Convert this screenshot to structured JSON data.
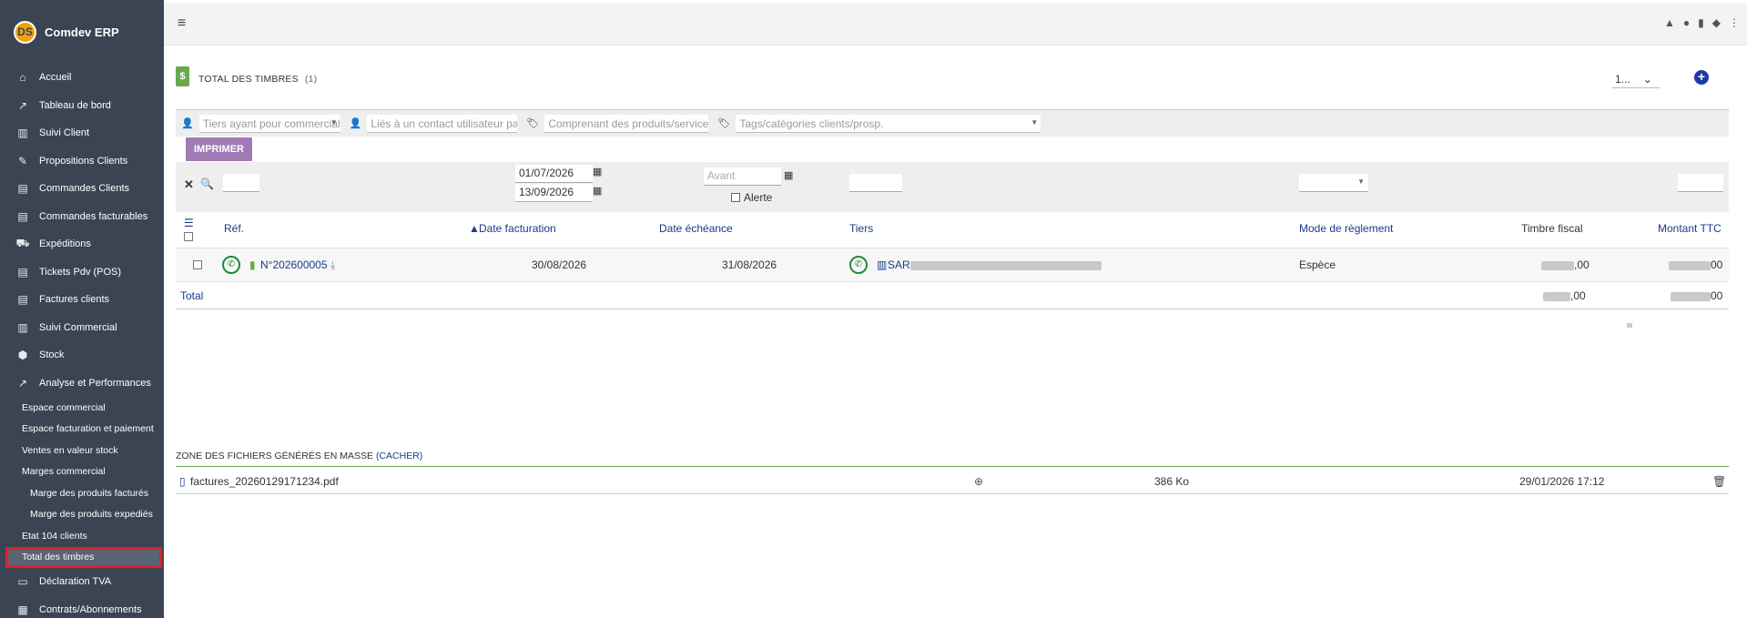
{
  "app": {
    "name": "Comdev ERP",
    "logo": "DS"
  },
  "sidebar": {
    "items": [
      {
        "label": "Accueil",
        "icon": "home-icon",
        "glyph": "⌂"
      },
      {
        "label": "Tableau de bord",
        "icon": "chart-line-icon",
        "glyph": "↗"
      },
      {
        "label": "Suivi Client",
        "icon": "building-icon",
        "glyph": "▥"
      },
      {
        "label": "Propositions Clients",
        "icon": "file-signature-icon",
        "glyph": "✎"
      },
      {
        "label": "Commandes Clients",
        "icon": "file-icon",
        "glyph": "▤"
      },
      {
        "label": "Commandes facturables",
        "icon": "file-icon",
        "glyph": "▤"
      },
      {
        "label": "Expéditions",
        "icon": "dolly-icon",
        "glyph": "⛟"
      },
      {
        "label": "Tickets Pdv (POS)",
        "icon": "file-icon",
        "glyph": "▤"
      },
      {
        "label": "Factures clients",
        "icon": "file-invoice-icon",
        "glyph": "▤"
      },
      {
        "label": "Suivi Commercial",
        "icon": "building-icon",
        "glyph": "▥"
      },
      {
        "label": "Stock",
        "icon": "box-icon",
        "glyph": "⬢"
      },
      {
        "label": "Analyse et Performances",
        "icon": "chart-line-icon",
        "glyph": "↗"
      }
    ],
    "subitems": [
      {
        "label": "Espace commercial",
        "level": 1
      },
      {
        "label": "Espace facturation et paiement",
        "level": 1
      },
      {
        "label": "Ventes en valeur stock",
        "level": 1
      },
      {
        "label": "Marges commercial",
        "level": 1
      },
      {
        "label": "Marge des produits facturés",
        "level": 2
      },
      {
        "label": "Marge des produits expediés",
        "level": 2
      },
      {
        "label": "Etat 104 clients",
        "level": 1
      },
      {
        "label": "Total des timbres",
        "level": 1,
        "active": true
      }
    ],
    "bottom_items": [
      {
        "label": "Déclaration TVA",
        "icon": "id-card-icon",
        "glyph": "▭"
      },
      {
        "label": "Contrats/Abonnements",
        "icon": "briefcase-icon",
        "glyph": "▦"
      }
    ]
  },
  "topbar": {
    "hamburger": "≡",
    "icons": [
      "▲",
      "●",
      "▮",
      "◆",
      "⋮"
    ]
  },
  "page": {
    "title": "TOTAL DES TIMBRES",
    "count": "(1)",
    "limit_value": "1...",
    "add_glyph": "+"
  },
  "filters": {
    "commercial_placeholder": "Tiers ayant pour commercial",
    "contact_placeholder": "Liés à un contact utilisateur partic",
    "products_placeholder": "Comprenant des produits/services",
    "tags_placeholder": "Tags/catégories clients/prosp."
  },
  "print_button": "IMPRIMER",
  "search": {
    "date_from": "01/07/2026",
    "date_to": "13/09/2026",
    "before_placeholder": "Avant",
    "alert_label": "Alerte"
  },
  "columns": {
    "ref": "Réf.",
    "date_invoice": "Date facturation",
    "date_due": "Date échéance",
    "third_party": "Tiers",
    "payment_mode": "Mode de règlement",
    "fiscal_stamp": "Timbre fiscal",
    "amount_ttc": "Montant TTC"
  },
  "rows": [
    {
      "ref": "N°202600005",
      "date_invoice": "30/08/2026",
      "date_due": "31/08/2026",
      "third_party": "SAR",
      "payment_mode": "Espèce",
      "fiscal_stamp_suffix": ",00",
      "amount_suffix": "00"
    }
  ],
  "total": {
    "label": "Total",
    "fiscal_stamp_suffix": ",00",
    "amount_suffix": "00"
  },
  "mass_zone": {
    "title": "ZONE DES FICHIERS GÉNÉRÉS EN MASSE",
    "toggle": "(CACHER)",
    "file_name": "factures_20260129171234.pdf",
    "file_size": "386 Ko",
    "file_date": "29/01/2026 17:12"
  }
}
